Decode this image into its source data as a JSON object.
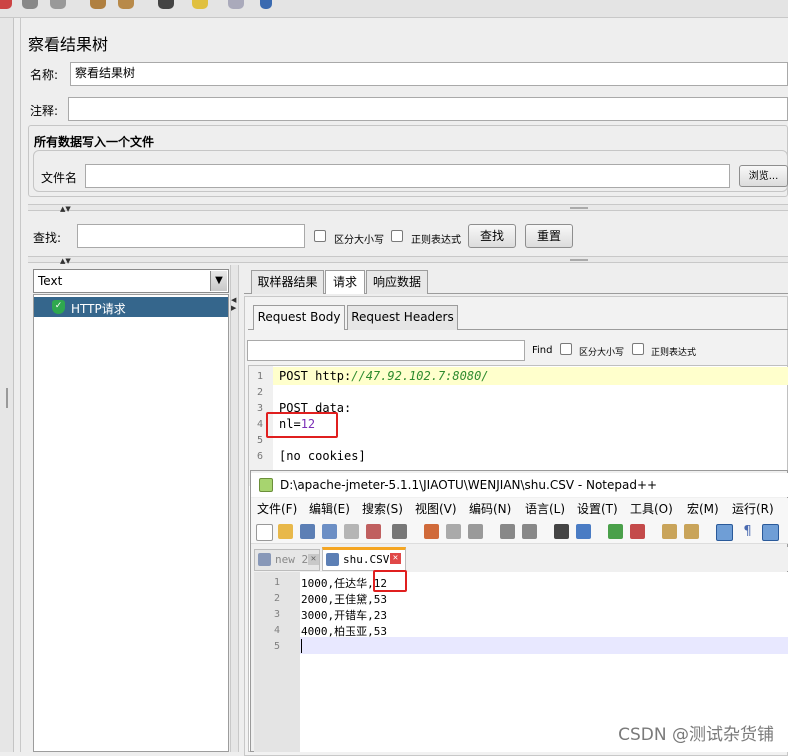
{
  "window": {
    "title": "察看结果树",
    "name_label": "名称:",
    "name_value": "察看结果树",
    "comment_label": "注释:",
    "comment_value": ""
  },
  "file_section": {
    "heading": "所有数据写入一个文件",
    "filename_label": "文件名",
    "filename_value": "",
    "browse_label": "浏览..."
  },
  "search": {
    "label": "查找:",
    "value": "",
    "case_label": "区分大小写",
    "regex_label": "正则表达式",
    "find_button": "查找",
    "reset_button": "重置"
  },
  "renderer": {
    "selected": "Text"
  },
  "tree": {
    "items": [
      {
        "label": "HTTP请求",
        "status": "success"
      }
    ]
  },
  "result_tabs": [
    "取样器结果",
    "请求",
    "响应数据"
  ],
  "result_tab_selected": "请求",
  "request_tabs": [
    "Request Body",
    "Request Headers"
  ],
  "request_tab_selected": "Request Body",
  "request_find": {
    "value": "",
    "find_label": "Find",
    "case_label": "区分大小写",
    "regex_label": "正则表达式"
  },
  "request_body": {
    "line_numbers": [
      "1",
      "2",
      "3",
      "4",
      "5",
      "6"
    ],
    "line1_prefix": "POST http:",
    "line1_url": "//47.92.102.7:8080/",
    "line2": "",
    "line3": "POST data:",
    "line4_key": "nl=",
    "line4_value": "12",
    "line5": "",
    "line6": "[no cookies]"
  },
  "notepad": {
    "title": "D:\\apache-jmeter-5.1.1\\JIAOTU\\WENJIAN\\shu.CSV - Notepad++",
    "menu": [
      "文件(F)",
      "编辑(E)",
      "搜索(S)",
      "视图(V)",
      "编码(N)",
      "语言(L)",
      "设置(T)",
      "工具(O)",
      "宏(M)",
      "运行(R)"
    ],
    "tabs": [
      "new 2",
      "shu.CSV"
    ],
    "active_tab": "shu.CSV",
    "line_numbers": [
      "1",
      "2",
      "3",
      "4",
      "5"
    ],
    "lines": [
      "1000,任达华,12",
      "2000,王佳黛,53",
      "3000,开错车,23",
      "4000,柏玉亚,53",
      ""
    ]
  },
  "watermark": "CSDN @测试杂货铺",
  "colors": {
    "tree_selection": "#35668c",
    "highlight_line": "#ffffcc",
    "url_green": "#2e8b2e",
    "number_purple": "#7a2eb6",
    "red_box": "#e01f1f",
    "np_current_line": "#e8e8ff"
  }
}
